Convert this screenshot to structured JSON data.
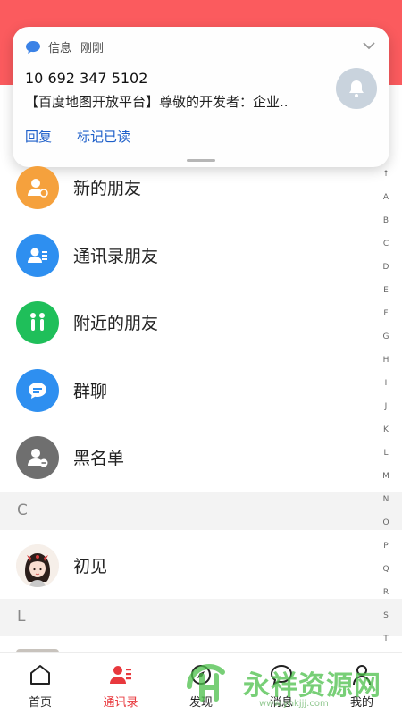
{
  "notification": {
    "app_name": "信息",
    "time": "刚刚",
    "sender": "10 692 347 5102",
    "body": "【百度地图开放平台】尊敬的开发者：企业..",
    "actions": [
      "回复",
      "标记已读"
    ]
  },
  "contacts": {
    "special_items": [
      {
        "label": "新的朋友",
        "icon": "new-friend-icon",
        "color": "#f5a13d"
      },
      {
        "label": "通讯录朋友",
        "icon": "address-book-icon",
        "color": "#2e8ff0"
      },
      {
        "label": "附近的朋友",
        "icon": "nearby-icon",
        "color": "#1fbf5a"
      },
      {
        "label": "群聊",
        "icon": "group-chat-icon",
        "color": "#2e8ff0"
      },
      {
        "label": "黑名单",
        "icon": "blacklist-icon",
        "color": "#6f6f6f"
      }
    ],
    "sections": [
      {
        "letter": "C",
        "items": [
          {
            "label": "初见"
          }
        ]
      },
      {
        "letter": "L",
        "items": []
      }
    ]
  },
  "alphabet_index": [
    "↑",
    "A",
    "B",
    "C",
    "D",
    "E",
    "F",
    "G",
    "H",
    "I",
    "J",
    "K",
    "L",
    "M",
    "N",
    "O",
    "P",
    "Q",
    "R",
    "S",
    "T"
  ],
  "bottom_nav": [
    {
      "label": "首页",
      "icon": "home-icon",
      "active": false
    },
    {
      "label": "通讯录",
      "icon": "contacts-icon",
      "active": true
    },
    {
      "label": "发现",
      "icon": "discover-icon",
      "active": false
    },
    {
      "label": "消息",
      "icon": "message-icon",
      "active": false
    },
    {
      "label": "我的",
      "icon": "profile-icon",
      "active": false
    }
  ],
  "watermark": {
    "text": "永祥资源网",
    "url": "www.yhkjjj.com"
  },
  "colors": {
    "header": "#fb5b5e",
    "accent": "#e8383d",
    "link": "#1e5fc9"
  }
}
